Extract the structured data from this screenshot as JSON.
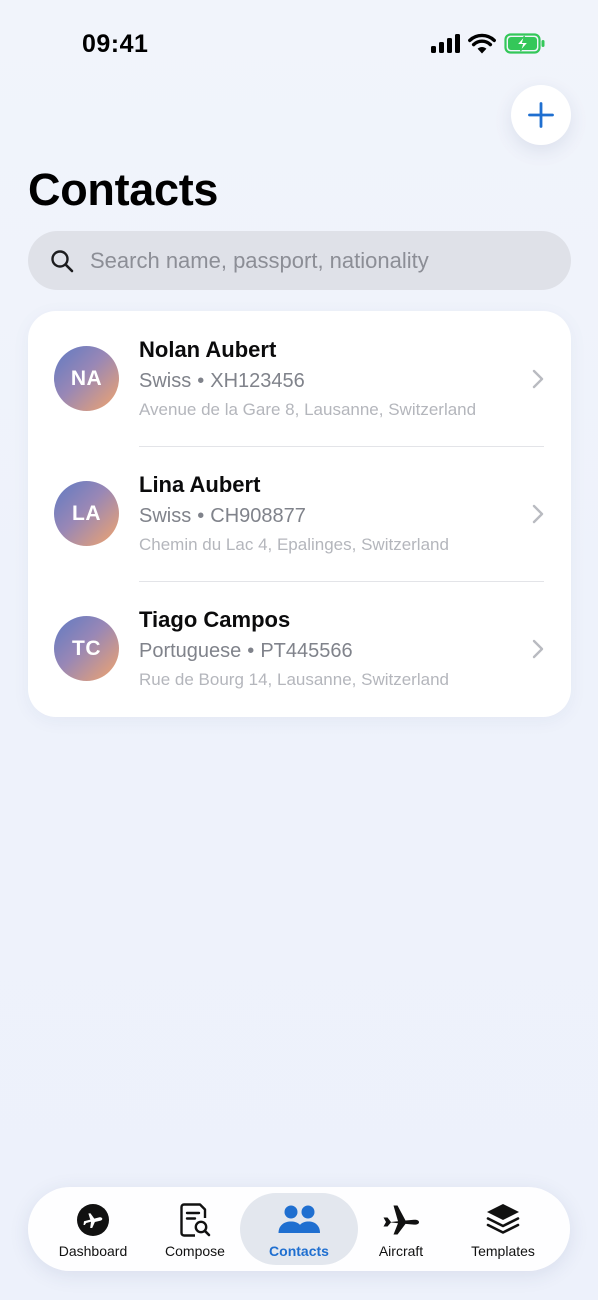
{
  "status_bar": {
    "time": "09:41"
  },
  "header": {
    "title": "Contacts",
    "add_icon": "plus-icon"
  },
  "search": {
    "placeholder": "Search name, passport, nationality",
    "value": ""
  },
  "contacts": [
    {
      "initials": "NA",
      "name": "Nolan Aubert",
      "nationality": "Swiss",
      "separator": "•",
      "passport": "XH123456",
      "address": "Avenue de la Gare 8, Lausanne, Switzerland"
    },
    {
      "initials": "LA",
      "name": "Lina Aubert",
      "nationality": "Swiss",
      "separator": "•",
      "passport": "CH908877",
      "address": "Chemin du Lac 4, Epalinges, Switzerland"
    },
    {
      "initials": "TC",
      "name": "Tiago Campos",
      "nationality": "Portuguese",
      "separator": "•",
      "passport": "PT445566",
      "address": "Rue de Bourg 14, Lausanne, Switzerland"
    }
  ],
  "tabs": [
    {
      "label": "Dashboard",
      "icon": "plane-circle-icon",
      "active": false
    },
    {
      "label": "Compose",
      "icon": "document-search-icon",
      "active": false
    },
    {
      "label": "Contacts",
      "icon": "people-icon",
      "active": true
    },
    {
      "label": "Aircraft",
      "icon": "airplane-icon",
      "active": false
    },
    {
      "label": "Templates",
      "icon": "layers-icon",
      "active": false
    }
  ],
  "colors": {
    "accent": "#1f6fd0",
    "battery": "#34c759",
    "background": "#eef2fb"
  }
}
